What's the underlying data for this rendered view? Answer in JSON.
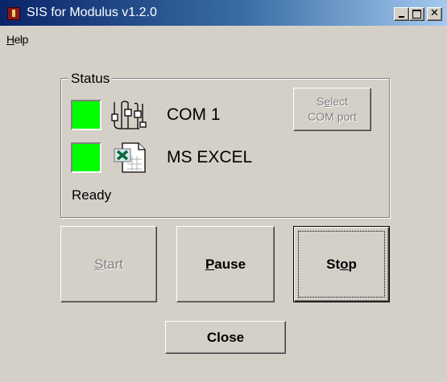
{
  "window": {
    "title": "SIS for Modulus v1.2.0",
    "controls": [
      "minimize",
      "maximize",
      "close"
    ],
    "close_glyph": "✕"
  },
  "menu": {
    "items": [
      {
        "label": "Help",
        "mnemonic": "H",
        "rest": "elp"
      }
    ]
  },
  "status_group": {
    "label": "Status",
    "com": {
      "indicator_color": "#00ff00",
      "icon": "serial-port-icon",
      "text": "COM 1"
    },
    "excel": {
      "indicator_color": "#00ff00",
      "icon": "excel-file-icon",
      "text": "MS EXCEL"
    },
    "select_com_button": {
      "line1_pre": "S",
      "line1_mnemonic": "e",
      "line1_post": "lect",
      "line2": "COM port",
      "enabled": false
    },
    "state_text": "Ready"
  },
  "buttons": {
    "start": {
      "mnemonic": "S",
      "rest": "tart",
      "enabled": false
    },
    "pause": {
      "mnemonic": "P",
      "rest": "ause",
      "enabled": true
    },
    "stop": {
      "pre": "St",
      "mnemonic": "o",
      "post": "p",
      "enabled": true,
      "default": true
    },
    "close": {
      "label": "Close",
      "enabled": true
    }
  }
}
